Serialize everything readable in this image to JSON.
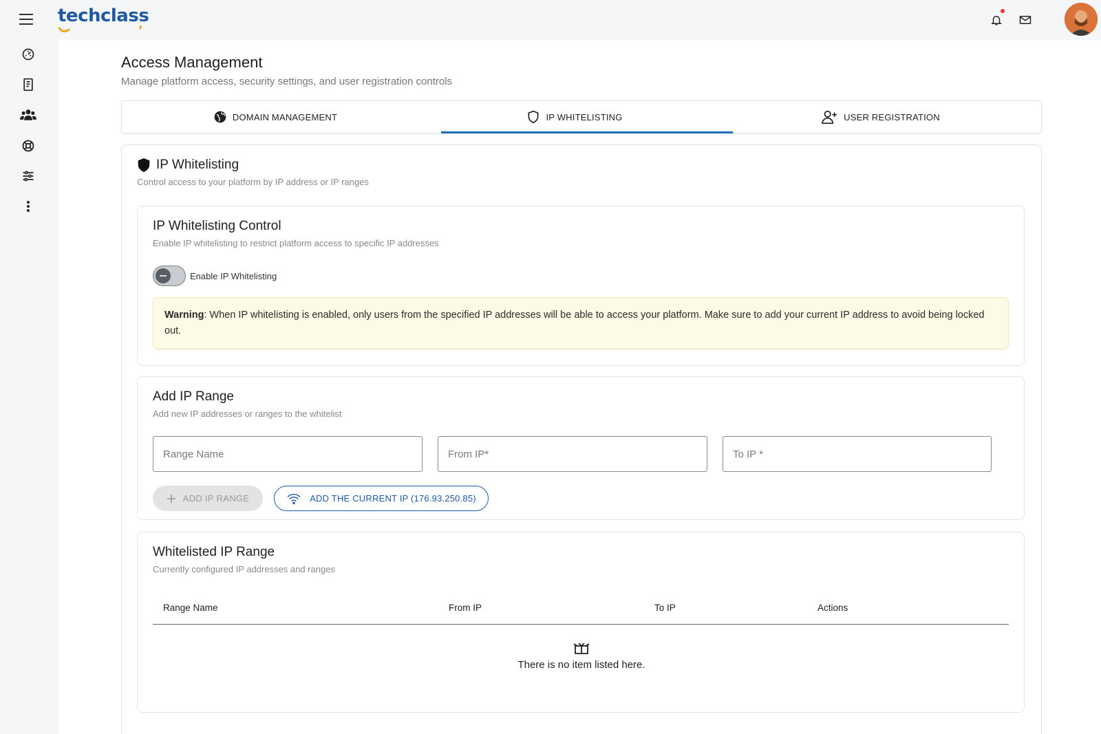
{
  "brand": {
    "name": "techclass",
    "accent": "#1e5aa8",
    "swoosh": "#f5a623"
  },
  "header": {
    "menu_icon": "hamburger-icon",
    "icons": [
      "bell-icon",
      "mail-icon"
    ],
    "avatar": "user-avatar"
  },
  "sidebar": {
    "items": [
      {
        "icon": "dashboard-icon"
      },
      {
        "icon": "book-icon"
      },
      {
        "icon": "users-icon"
      },
      {
        "icon": "support-icon"
      },
      {
        "icon": "sliders-icon"
      },
      {
        "icon": "more-vertical-icon"
      }
    ]
  },
  "page": {
    "title": "Access Management",
    "subtitle": "Manage platform access, security settings, and user registration controls"
  },
  "tabs": [
    {
      "label": "DOMAIN MANAGEMENT",
      "icon": "globe-icon",
      "active": false
    },
    {
      "label": "IP WHITELISTING",
      "icon": "shield-icon",
      "active": true
    },
    {
      "label": "USER REGISTRATION",
      "icon": "user-plus-icon",
      "active": false
    }
  ],
  "section": {
    "title": "IP Whitelisting",
    "subtitle": "Control access to your platform by IP address or IP ranges"
  },
  "control": {
    "title": "IP Whitelisting Control",
    "subtitle": "Enable IP whitelisting to restrict platform access to specific IP addresses",
    "toggle_label": "Enable IP Whitelisting",
    "toggle_on": false,
    "warning_label": "Warning",
    "warning_text": ": When IP whitelisting is enabled, only users from the specified IP addresses will be able to access your platform. Make sure to add your current IP address to avoid being locked out."
  },
  "add_range": {
    "title": "Add IP Range",
    "subtitle": "Add new IP addresses or ranges to the whitelist",
    "range_name_placeholder": "Range Name",
    "from_ip_placeholder": "From IP*",
    "to_ip_placeholder": "To IP *",
    "add_button": "ADD IP RANGE",
    "current_ip_button": "ADD THE CURRENT IP (176.93.250.85)"
  },
  "whitelisted": {
    "title": "Whitelisted IP Range",
    "subtitle": "Currently configured IP addresses and ranges",
    "columns": [
      "Range Name",
      "From IP",
      "To IP",
      "Actions"
    ],
    "rows": [],
    "empty_text": "There is no item listed here."
  }
}
